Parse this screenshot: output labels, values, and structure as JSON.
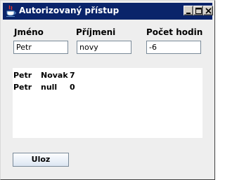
{
  "window": {
    "title": "Autorizovaný přístup",
    "icon": "java-cup-icon",
    "controls": [
      "minimize-icon",
      "maximize-icon",
      "close-icon"
    ]
  },
  "form": {
    "jmeno": {
      "label": "Jméno",
      "value": "Petr"
    },
    "prijmeni": {
      "label": "Příjmeni",
      "value": "novy"
    },
    "pocet_hodin": {
      "label": "Počet hodin",
      "value": "-6"
    }
  },
  "list": {
    "rows": [
      [
        "Petr",
        "Novak",
        "7"
      ],
      [
        "Petr",
        "null",
        "0"
      ]
    ]
  },
  "actions": {
    "save_label": "Uloz"
  },
  "colors": {
    "titlebar": "#0a246a",
    "window_bg": "#eeeeee",
    "field_border": "#7a8a99"
  }
}
